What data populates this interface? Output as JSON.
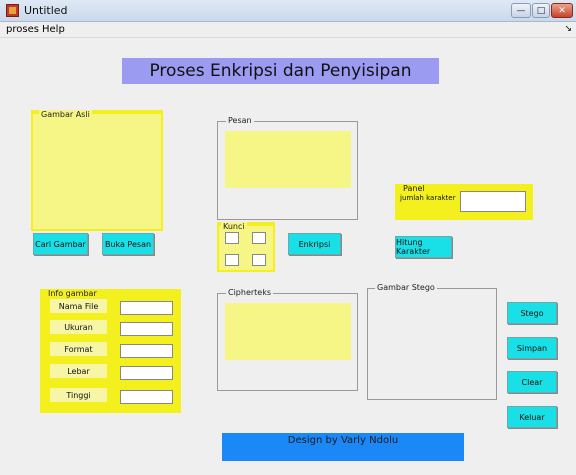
{
  "window": {
    "title": "Untitled"
  },
  "menu": {
    "items": [
      "proses",
      "Help"
    ]
  },
  "heading": "Proses Enkripsi dan Penyisipan",
  "gambar_asli": {
    "label": "Gambar Asli"
  },
  "pesan": {
    "label": "Pesan"
  },
  "kunci": {
    "label": "Kunci"
  },
  "panel": {
    "label": "Panel",
    "jumlah_label": "jumlah karakter"
  },
  "info_gambar": {
    "label": "Info gambar",
    "fields": [
      "Nama File",
      "Ukuran",
      "Format",
      "Lebar",
      "Tinggi"
    ]
  },
  "cipherteks": {
    "label": "Cipherteks"
  },
  "gambar_stego": {
    "label": "Gambar Stego"
  },
  "buttons": {
    "cari_gambar": "Cari Gambar",
    "buka_pesan": "Buka Pesan",
    "enkripsi": "Enkripsi",
    "hitung_karakter": "Hitung Karakter",
    "stego": "Stego",
    "simpan": "Simpan",
    "clear": "Clear",
    "keluar": "Keluar"
  },
  "footer": "Design by Varly Ndolu",
  "colors": {
    "panel_yellow": "#f3f01e",
    "area_yellow": "#f6f686",
    "button_cyan": "#19e0e6",
    "heading_purple": "#9b9bf2",
    "footer_blue": "#1a88f6"
  }
}
